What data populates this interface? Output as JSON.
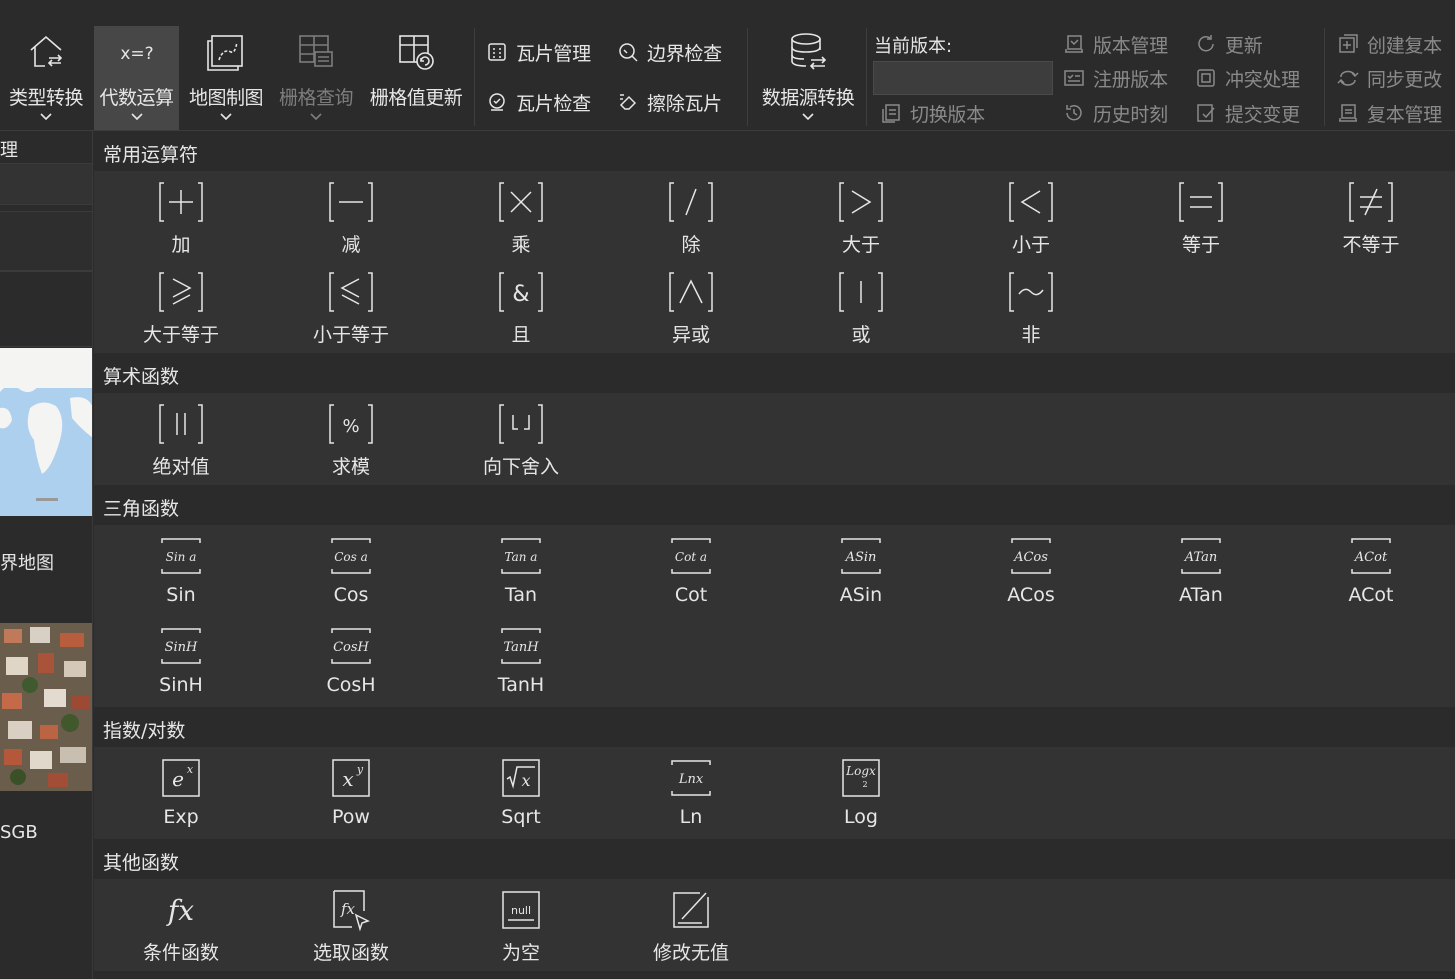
{
  "colors": {
    "background": "#2b2b2b",
    "section_body": "#333333",
    "active_tab": "#474747",
    "text": "#e6e6e6",
    "disabled_text": "#8a8a8a"
  },
  "ribbon": {
    "big_buttons": [
      {
        "label": "类型转换",
        "icon": "house-convert-icon",
        "dropdown": true
      },
      {
        "label": "代数运算",
        "icon": "equation-icon",
        "dropdown": true,
        "active": true
      },
      {
        "label": "地图制图",
        "icon": "map-draw-icon",
        "dropdown": true
      },
      {
        "label": "栅格查询",
        "icon": "raster-query-icon",
        "dropdown": true,
        "disabled": true
      },
      {
        "label": "栅格值更新",
        "icon": "raster-update-icon",
        "dropdown": false
      },
      {
        "label": "数据源转换",
        "icon": "database-convert-icon",
        "dropdown": true
      }
    ],
    "tile_buttons": [
      {
        "label": "瓦片管理",
        "icon": "tile-manage-icon"
      },
      {
        "label": "边界检查",
        "icon": "boundary-check-icon"
      },
      {
        "label": "瓦片检查",
        "icon": "tile-check-icon"
      },
      {
        "label": "擦除瓦片",
        "icon": "erase-tile-icon"
      }
    ],
    "version": {
      "label": "当前版本:",
      "value": "",
      "switch_label": "切换版本",
      "manage_label": "版本管理",
      "register_label": "注册版本",
      "history_label": "历史时刻",
      "update_label": "更新",
      "conflict_label": "冲突处理",
      "commit_label": "提交变更",
      "create_replica_label": "创建复本",
      "sync_label": "同步更改",
      "replica_manage_label": "复本管理"
    }
  },
  "left_panel": {
    "top_text": "理",
    "map1_text": "界地图",
    "map2_text": "SGB"
  },
  "sections": [
    {
      "title": "常用运算符",
      "items": [
        {
          "label": "加",
          "icon": "plus-icon"
        },
        {
          "label": "减",
          "icon": "minus-icon"
        },
        {
          "label": "乘",
          "icon": "multiply-icon"
        },
        {
          "label": "除",
          "icon": "divide-icon"
        },
        {
          "label": "大于",
          "icon": "greater-than-icon"
        },
        {
          "label": "小于",
          "icon": "less-than-icon"
        },
        {
          "label": "等于",
          "icon": "equals-icon"
        },
        {
          "label": "不等于",
          "icon": "not-equal-icon"
        },
        {
          "label": "大于等于",
          "icon": "greater-equal-icon"
        },
        {
          "label": "小于等于",
          "icon": "less-equal-icon"
        },
        {
          "label": "且",
          "icon": "and-icon"
        },
        {
          "label": "异或",
          "icon": "xor-icon"
        },
        {
          "label": "或",
          "icon": "or-icon"
        },
        {
          "label": "非",
          "icon": "not-icon"
        }
      ]
    },
    {
      "title": "算术函数",
      "items": [
        {
          "label": "绝对值",
          "icon": "abs-icon"
        },
        {
          "label": "求模",
          "icon": "mod-icon"
        },
        {
          "label": "向下舍入",
          "icon": "floor-icon"
        }
      ]
    },
    {
      "title": "三角函数",
      "items": [
        {
          "label": "Sin",
          "icon": "sin-icon",
          "glyph": "Sin a"
        },
        {
          "label": "Cos",
          "icon": "cos-icon",
          "glyph": "Cos a"
        },
        {
          "label": "Tan",
          "icon": "tan-icon",
          "glyph": "Tan a"
        },
        {
          "label": "Cot",
          "icon": "cot-icon",
          "glyph": "Cot a"
        },
        {
          "label": "ASin",
          "icon": "asin-icon",
          "glyph": "ASin"
        },
        {
          "label": "ACos",
          "icon": "acos-icon",
          "glyph": "ACos"
        },
        {
          "label": "ATan",
          "icon": "atan-icon",
          "glyph": "ATan"
        },
        {
          "label": "ACot",
          "icon": "acot-icon",
          "glyph": "ACot"
        },
        {
          "label": "SinH",
          "icon": "sinh-icon",
          "glyph": "SinH"
        },
        {
          "label": "CosH",
          "icon": "cosh-icon",
          "glyph": "CosH"
        },
        {
          "label": "TanH",
          "icon": "tanh-icon",
          "glyph": "TanH"
        }
      ]
    },
    {
      "title": "指数/对数",
      "items": [
        {
          "label": "Exp",
          "icon": "exp-icon"
        },
        {
          "label": "Pow",
          "icon": "pow-icon"
        },
        {
          "label": "Sqrt",
          "icon": "sqrt-icon"
        },
        {
          "label": "Ln",
          "icon": "ln-icon",
          "glyph": "Lnx"
        },
        {
          "label": "Log",
          "icon": "log-icon",
          "glyph": "Logx"
        }
      ]
    },
    {
      "title": "其他函数",
      "items": [
        {
          "label": "条件函数",
          "icon": "fx-icon"
        },
        {
          "label": "选取函数",
          "icon": "fx-select-icon"
        },
        {
          "label": "为空",
          "icon": "null-icon",
          "glyph": "null"
        },
        {
          "label": "修改无值",
          "icon": "edit-nodata-icon"
        }
      ]
    }
  ]
}
